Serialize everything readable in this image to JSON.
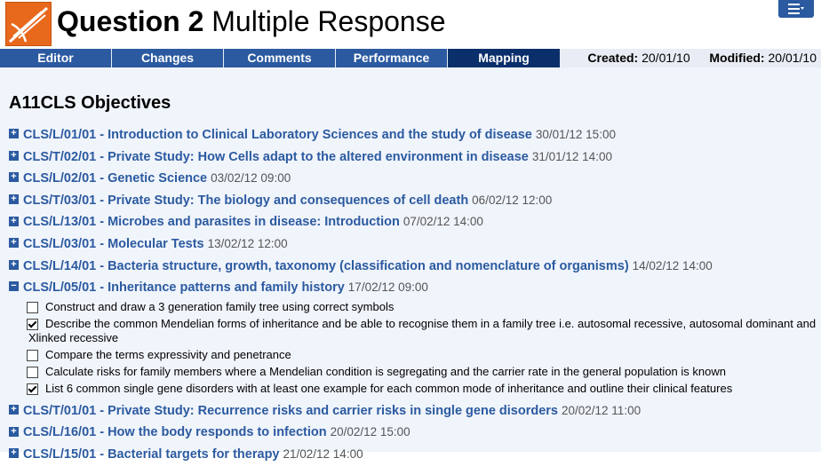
{
  "header": {
    "title_bold": "Question 2",
    "title_rest": "Multiple Response"
  },
  "colors": {
    "accent": "#2b5aa0",
    "active_tab": "#0b2f6b",
    "logo": "#e8681c",
    "content_bg": "#f0f4fb"
  },
  "icons": {
    "logo": "app-logo-icon",
    "menu": "hamburger-menu-icon",
    "expand": "plus-icon",
    "collapse": "minus-icon"
  },
  "tabs": [
    {
      "label": "Editor"
    },
    {
      "label": "Changes"
    },
    {
      "label": "Comments"
    },
    {
      "label": "Performance"
    },
    {
      "label": "Mapping",
      "active": true
    }
  ],
  "meta": {
    "created_label": "Created:",
    "created_value": "20/01/10",
    "modified_label": "Modified:",
    "modified_value": "20/01/10"
  },
  "section_title": "A11CLS Objectives",
  "objectives_before": [
    {
      "title": "CLS/L/01/01 - Introduction to Clinical Laboratory Sciences and the study of disease",
      "date": "30/01/12 15:00"
    },
    {
      "title": "CLS/T/02/01 - Private Study: How Cells adapt to the altered environment in disease",
      "date": "31/01/12 14:00"
    },
    {
      "title": "CLS/L/02/01 - Genetic Science",
      "date": "03/02/12 09:00"
    },
    {
      "title": "CLS/T/03/01 - Private Study: The biology and consequences of cell death",
      "date": "06/02/12 12:00"
    },
    {
      "title": "CLS/L/13/01 - Microbes and parasites in disease: Introduction",
      "date": "07/02/12 14:00"
    },
    {
      "title": "CLS/L/03/01 - Molecular Tests",
      "date": "13/02/12 12:00"
    },
    {
      "title": "CLS/L/14/01 - Bacteria structure, growth, taxonomy (classification and nomenclature of organisms)",
      "date": "14/02/12 14:00"
    }
  ],
  "expanded": {
    "title": "CLS/L/05/01 - Inheritance patterns and family history",
    "date": "17/02/12 09:00",
    "items": [
      {
        "text": "Construct and draw a 3 generation family tree using correct symbols",
        "checked": false
      },
      {
        "text": "Describe the common Mendelian forms of inheritance and be able to recognise them in a family tree i.e. autosomal recessive, autosomal dominant and",
        "text2": "Xlinked recessive",
        "checked": true
      },
      {
        "text": "Compare the terms expressivity and penetrance",
        "checked": false
      },
      {
        "text": "Calculate risks for family members where a Mendelian condition is segregating and the carrier rate in the general population is known",
        "checked": false
      },
      {
        "text": "List 6 common single gene disorders with at least one example for each common mode of inheritance and outline their clinical features",
        "checked": true
      }
    ]
  },
  "objectives_after": [
    {
      "title": "CLS/T/01/01 - Private Study: Recurrence risks and carrier risks in single gene disorders",
      "date": "20/02/12 11:00"
    },
    {
      "title": "CLS/L/16/01 - How the body responds to infection",
      "date": "20/02/12 15:00"
    },
    {
      "title": "CLS/L/15/01 - Bacterial targets for therapy",
      "date": "21/02/12 14:00"
    }
  ]
}
